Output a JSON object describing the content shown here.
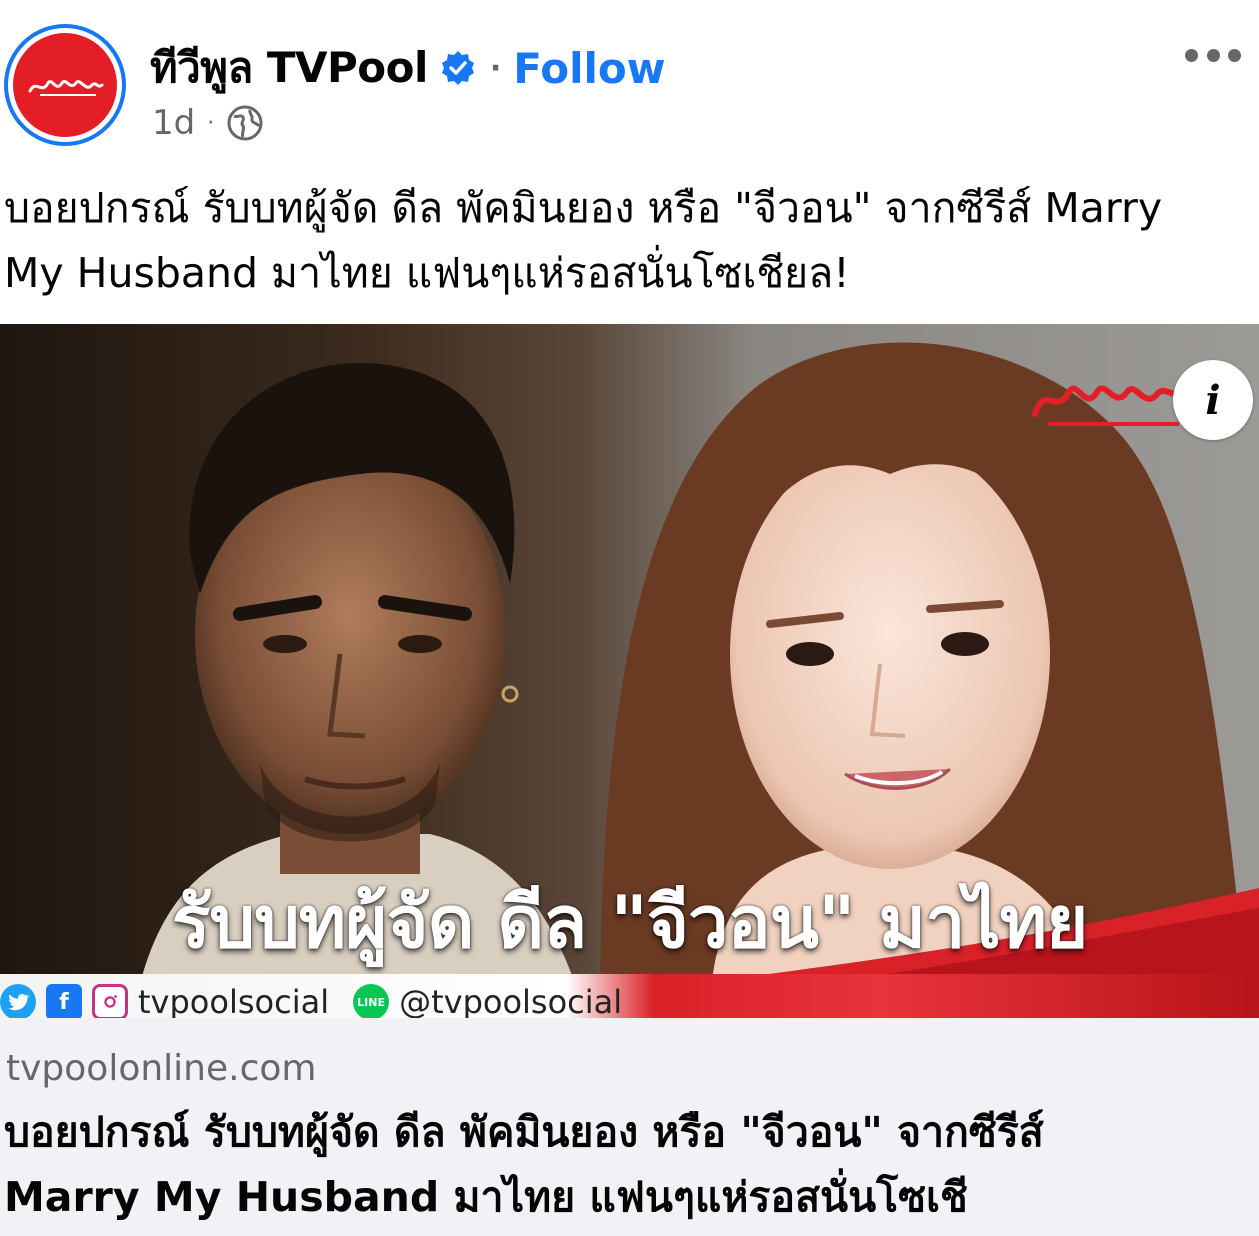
{
  "colors": {
    "facebook_blue": "#1877f2",
    "brand_red": "#e41e26",
    "secondary_text": "#65676b",
    "link_box_bg": "#f0f2f5"
  },
  "header": {
    "page_name": "ทีวีพูล TVPool",
    "verified_icon": "verified-badge-icon",
    "separator": "·",
    "follow_label": "Follow",
    "timestamp": "1d",
    "meta_separator": "·",
    "audience_icon": "globe-icon",
    "more_icon": "more-options-icon"
  },
  "post": {
    "caption_line1": "บอยปกรณ์ รับบทผู้จัด ดีล พัคมินยอง หรือ \"จีวอน\" จากซีรีส์ Marry",
    "caption_line2": "My Husband มาไทย แฟนๆแห่รอสนั่นโซเชียล!"
  },
  "image": {
    "headline": "รับบทผู้จัด ดีล \"จีวอน\" มาไทย",
    "info_icon": "info-icon",
    "info_label": "i",
    "social": [
      {
        "icon": "twitter-icon"
      },
      {
        "icon": "facebook-icon",
        "glyph": "f"
      },
      {
        "icon": "instagram-icon",
        "handle": "tvpoolsocial"
      },
      {
        "icon": "line-icon",
        "glyph": "LINE",
        "handle": "@tvpoolsocial"
      }
    ]
  },
  "link_preview": {
    "domain": "tvpoolonline.com",
    "title_line1": "บอยปกรณ์ รับบทผู้จัด ดีล พัคมินยอง หรือ \"จีวอน\" จากซีรีส์",
    "title_line2": "Marry My Husband มาไทย แฟนๆแห่รอสนั่นโซเชี"
  }
}
